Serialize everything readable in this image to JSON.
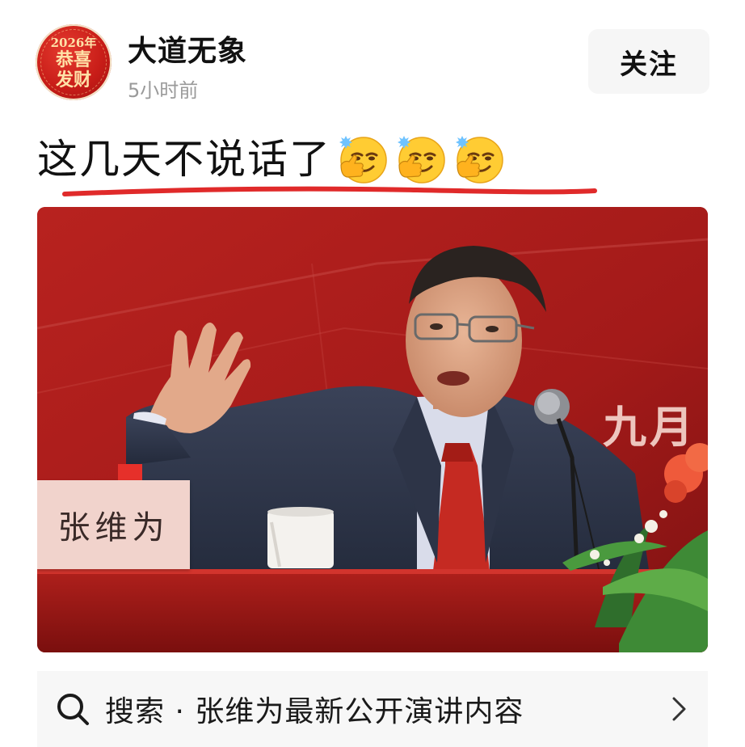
{
  "header": {
    "avatar": {
      "year": "2026年",
      "line1": "恭喜",
      "line2": "发财"
    },
    "username": "大道无象",
    "time": "5小时前",
    "follow_label": "关注"
  },
  "post": {
    "text": "这几天不说话了",
    "emojis": [
      "smirk-thumb-emoji",
      "smirk-thumb-emoji",
      "smirk-thumb-emoji"
    ],
    "underline_color": "#e02a2a"
  },
  "photo": {
    "nameplate": "张维为",
    "banner_fragment": "九月",
    "background_color": "#a41a1a"
  },
  "search": {
    "icon": "search-icon",
    "text": "搜索 · 张维为最新公开演讲内容",
    "chevron": "chevron-right-icon"
  }
}
